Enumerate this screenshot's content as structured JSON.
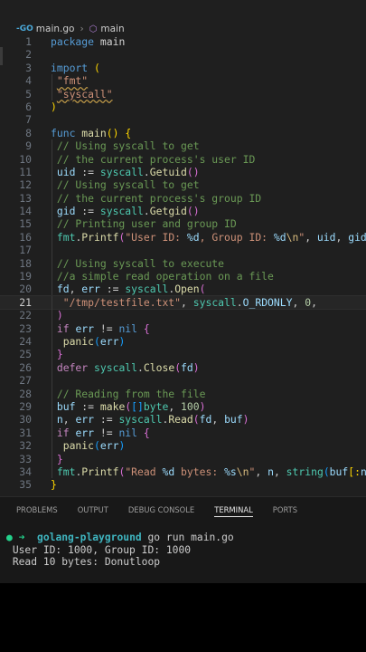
{
  "breadcrumb": {
    "badge": "-GO",
    "file": "main.go",
    "symbol": "main"
  },
  "editor": {
    "current_line": 21,
    "lines": [
      {
        "n": "1"
      },
      {
        "n": "2"
      },
      {
        "n": "3"
      },
      {
        "n": "4"
      },
      {
        "n": "5"
      },
      {
        "n": "6"
      },
      {
        "n": "7"
      },
      {
        "n": "8"
      },
      {
        "n": "9"
      },
      {
        "n": "10"
      },
      {
        "n": "11"
      },
      {
        "n": "12"
      },
      {
        "n": "13"
      },
      {
        "n": "14"
      },
      {
        "n": "15"
      },
      {
        "n": "16"
      },
      {
        "n": "17"
      },
      {
        "n": "18"
      },
      {
        "n": "19"
      },
      {
        "n": "20"
      },
      {
        "n": "21"
      },
      {
        "n": "22"
      },
      {
        "n": "23"
      },
      {
        "n": "24"
      },
      {
        "n": "25"
      },
      {
        "n": "26"
      },
      {
        "n": "27"
      },
      {
        "n": "28"
      },
      {
        "n": "29"
      },
      {
        "n": "30"
      },
      {
        "n": "31"
      },
      {
        "n": "32"
      },
      {
        "n": "33"
      },
      {
        "n": "34"
      },
      {
        "n": "35"
      }
    ],
    "code": {
      "l1_kw": "package",
      "l1_name": "main",
      "l3_kw": "import",
      "l4": "\"fmt\"",
      "l5": "\"syscall\"",
      "l8_kw": "func",
      "l8_name": "main",
      "l9": "// Using syscall to get",
      "l10": "// the current process's user ID",
      "l11_var": "uid",
      "l11_pkg": "syscall",
      "l11_fn": "Getuid",
      "l12": "// Using syscall to get",
      "l13": "// the current process's group ID",
      "l14_var": "gid",
      "l14_pkg": "syscall",
      "l14_fn": "Getgid",
      "l15": "// Printing user and group ID",
      "l16_pkg": "fmt",
      "l16_fn": "Printf",
      "l16_str_a": "\"User ID: ",
      "l16_fmt1": "%d",
      "l16_str_b": ", Group ID: ",
      "l16_fmt2": "%d",
      "l16_esc": "\\n",
      "l16_str_c": "\"",
      "l16_a1": "uid",
      "l16_a2": "gid",
      "l18": "// Using syscall to execute",
      "l19": "//a simple read operation on a file",
      "l20_v1": "fd",
      "l20_v2": "err",
      "l20_pkg": "syscall",
      "l20_fn": "Open",
      "l21_str": "\"/tmp/testfile.txt\"",
      "l21_pkg": "syscall",
      "l21_const": "O_RDONLY",
      "l21_num": "0",
      "l23_kw": "if",
      "l23_var": "err",
      "l23_nil": "nil",
      "l24_fn": "panic",
      "l24_var": "err",
      "l26_kw": "defer",
      "l26_pkg": "syscall",
      "l26_fn": "Close",
      "l26_var": "fd",
      "l28": "// Reading from the file",
      "l29_var": "buf",
      "l29_fn": "make",
      "l29_ty": "byte",
      "l29_num": "100",
      "l30_v1": "n",
      "l30_v2": "err",
      "l30_pkg": "syscall",
      "l30_fn": "Read",
      "l30_a1": "fd",
      "l30_a2": "buf",
      "l31_kw": "if",
      "l31_var": "err",
      "l31_nil": "nil",
      "l32_fn": "panic",
      "l32_var": "err",
      "l34_pkg": "fmt",
      "l34_fn": "Printf",
      "l34_str_a": "\"Read ",
      "l34_fmt1": "%d",
      "l34_str_b": " bytes: ",
      "l34_fmt2": "%s",
      "l34_esc": "\\n",
      "l34_str_c": "\"",
      "l34_a1": "n",
      "l34_ty": "string",
      "l34_a2": "buf",
      "l34_a3": "n"
    }
  },
  "panel": {
    "tabs": [
      "PROBLEMS",
      "OUTPUT",
      "DEBUG CONSOLE",
      "TERMINAL",
      "PORTS"
    ],
    "active_tab": "TERMINAL"
  },
  "terminal": {
    "cwd": "golang-playground",
    "command": "go run main.go",
    "output": [
      "User ID: 1000, Group ID: 1000",
      "Read 10 bytes: Donutloop"
    ]
  },
  "colors": {
    "background": "#1f1f1f",
    "keyword": "#569cd6",
    "string": "#ce9178",
    "comment": "#6a9955",
    "function": "#dcdcaa",
    "prompt": "#23d18b"
  }
}
